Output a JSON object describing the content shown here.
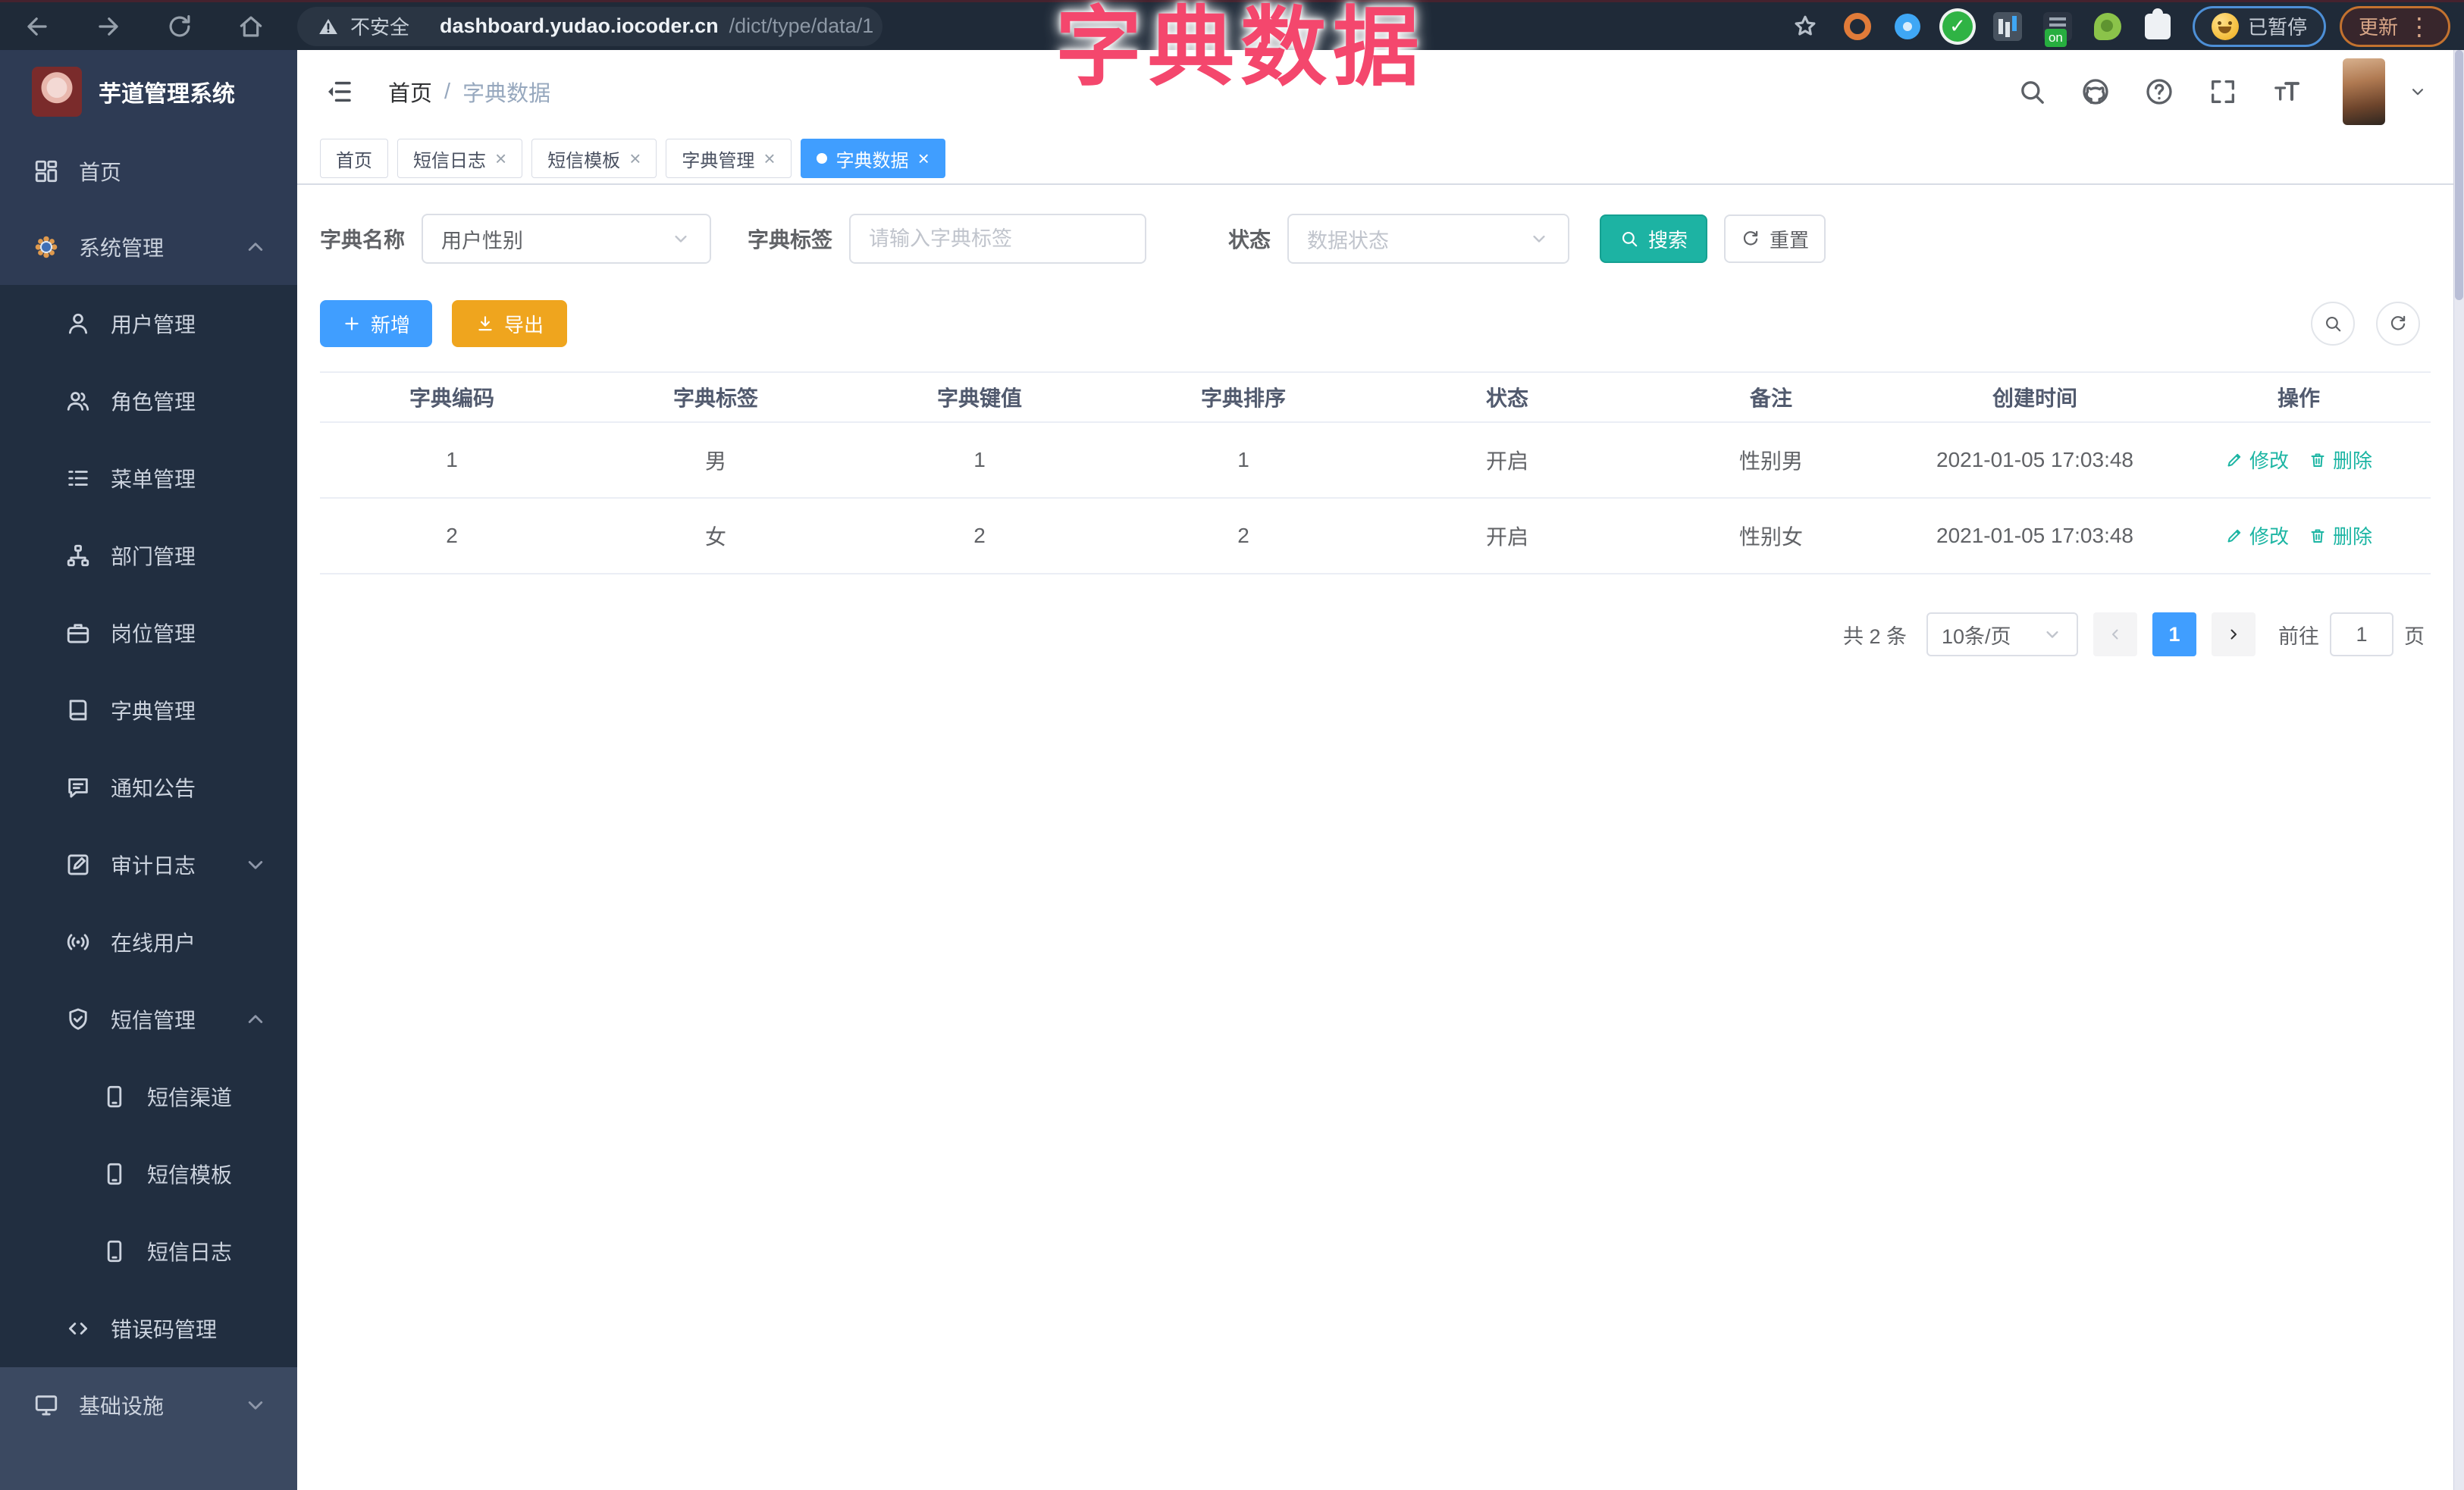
{
  "browser": {
    "security_text": "不安全",
    "url_host": "dashboard.yudao.iocoder.cn",
    "url_path": "/dict/type/data/1",
    "paused_badge": "已暂停",
    "update_button": "更新"
  },
  "overlay_title": "字典数据",
  "sidebar": {
    "app_title": "芋道管理系统",
    "items": [
      {
        "id": "home",
        "label": "首页",
        "icon": "dashboard-icon",
        "level": 0,
        "zone": "top",
        "chevron": null
      },
      {
        "id": "system",
        "label": "系统管理",
        "icon": "gear-icon",
        "level": 0,
        "zone": "top",
        "chevron": "up"
      },
      {
        "id": "users",
        "label": "用户管理",
        "icon": "user-icon",
        "level": 1,
        "zone": "sub",
        "chevron": null
      },
      {
        "id": "roles",
        "label": "角色管理",
        "icon": "users-icon",
        "level": 1,
        "zone": "sub",
        "chevron": null
      },
      {
        "id": "menus",
        "label": "菜单管理",
        "icon": "menu-list-icon",
        "level": 1,
        "zone": "sub",
        "chevron": null
      },
      {
        "id": "depts",
        "label": "部门管理",
        "icon": "tree-icon",
        "level": 1,
        "zone": "sub",
        "chevron": null
      },
      {
        "id": "posts",
        "label": "岗位管理",
        "icon": "briefcase-icon",
        "level": 1,
        "zone": "sub",
        "chevron": null
      },
      {
        "id": "dict",
        "label": "字典管理",
        "icon": "book-icon",
        "level": 1,
        "zone": "sub",
        "chevron": null
      },
      {
        "id": "notice",
        "label": "通知公告",
        "icon": "message-icon",
        "level": 1,
        "zone": "sub",
        "chevron": null
      },
      {
        "id": "audit-log",
        "label": "审计日志",
        "icon": "edit-square-icon",
        "level": 1,
        "zone": "sub",
        "chevron": "down"
      },
      {
        "id": "online-users",
        "label": "在线用户",
        "icon": "online-icon",
        "level": 1,
        "zone": "sub",
        "chevron": null
      },
      {
        "id": "sms",
        "label": "短信管理",
        "icon": "shield-icon",
        "level": 1,
        "zone": "sub",
        "chevron": "up"
      },
      {
        "id": "sms-channel",
        "label": "短信渠道",
        "icon": "phone-icon",
        "level": 2,
        "zone": "sub",
        "chevron": null
      },
      {
        "id": "sms-template",
        "label": "短信模板",
        "icon": "phone-icon",
        "level": 2,
        "zone": "sub",
        "chevron": null
      },
      {
        "id": "sms-log",
        "label": "短信日志",
        "icon": "phone-icon",
        "level": 2,
        "zone": "sub",
        "chevron": null
      },
      {
        "id": "error-code",
        "label": "错误码管理",
        "icon": "code-icon",
        "level": 1,
        "zone": "sub",
        "chevron": null
      },
      {
        "id": "infra",
        "label": "基础设施",
        "icon": "monitor-icon",
        "level": 0,
        "zone": "bottom",
        "chevron": "down"
      }
    ]
  },
  "header": {
    "breadcrumb_home": "首页",
    "breadcrumb_separator": "/",
    "breadcrumb_current": "字典数据"
  },
  "tabs": [
    {
      "label": "首页",
      "active": false,
      "closable": false
    },
    {
      "label": "短信日志",
      "active": false,
      "closable": true
    },
    {
      "label": "短信模板",
      "active": false,
      "closable": true
    },
    {
      "label": "字典管理",
      "active": false,
      "closable": true
    },
    {
      "label": "字典数据",
      "active": true,
      "closable": true
    }
  ],
  "filter": {
    "name_label": "字典名称",
    "name_value": "用户性别",
    "tag_label": "字典标签",
    "tag_placeholder": "请输入字典标签",
    "status_label": "状态",
    "status_placeholder": "数据状态",
    "search_label": "搜索",
    "reset_label": "重置"
  },
  "toolbar": {
    "add_label": "新增",
    "export_label": "导出"
  },
  "table": {
    "headers": [
      "字典编码",
      "字典标签",
      "字典键值",
      "字典排序",
      "状态",
      "备注",
      "创建时间",
      "操作"
    ],
    "rows": [
      [
        "1",
        "男",
        "1",
        "1",
        "开启",
        "性别男",
        "2021-01-05 17:03:48"
      ],
      [
        "2",
        "女",
        "2",
        "2",
        "开启",
        "性别女",
        "2021-01-05 17:03:48"
      ]
    ],
    "action_edit": "修改",
    "action_delete": "删除"
  },
  "pagination": {
    "total_text": "共 2 条",
    "page_size": "10条/页",
    "current_page": "1",
    "goto_label": "前往",
    "goto_value": "1",
    "page_unit": "页"
  },
  "colors": {
    "primary": "#409EFF",
    "search_teal": "#1DB3A3",
    "export_orange": "#EFA51E",
    "overlay_pink": "#F4476D",
    "sidebar_bg": "#2E3B54",
    "submenu_bg": "#212E40"
  }
}
